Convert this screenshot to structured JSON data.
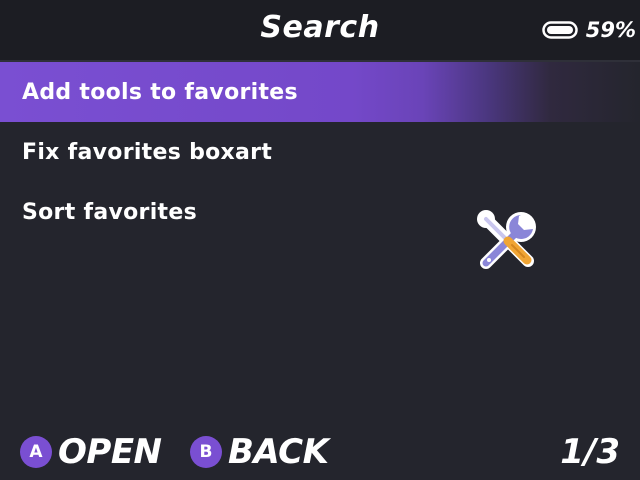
{
  "header": {
    "title": "Search",
    "battery_percent": "59%",
    "battery_icon": "battery-icon"
  },
  "menu": {
    "items": [
      {
        "label": "Add tools to favorites",
        "selected": true
      },
      {
        "label": "Fix favorites boxart",
        "selected": false
      },
      {
        "label": "Sort favorites",
        "selected": false
      }
    ]
  },
  "preview": {
    "icon": "tools-icon"
  },
  "footer": {
    "a_button": "A",
    "a_label": "OPEN",
    "b_button": "B",
    "b_label": "BACK",
    "page": "1/3"
  },
  "colors": {
    "accent": "#7a4fd2",
    "background": "#24252d",
    "header_background": "#1c1d23"
  }
}
